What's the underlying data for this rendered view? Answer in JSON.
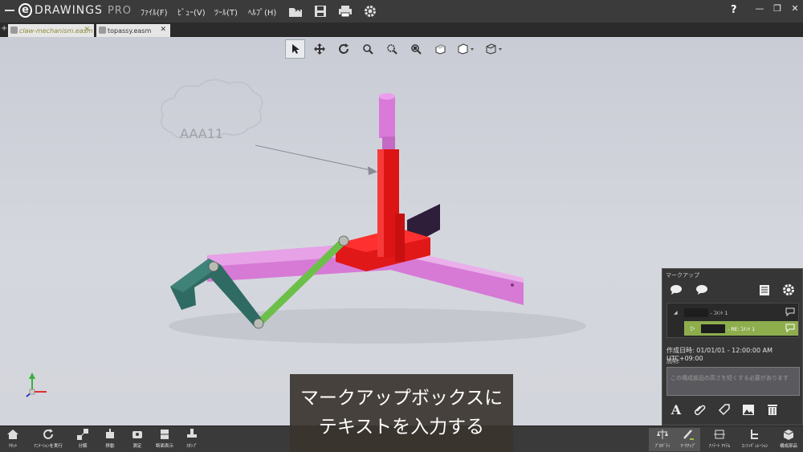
{
  "app": {
    "name": "DRAWINGS",
    "edition": "PRO",
    "logo_letter": "e"
  },
  "menu": [
    "ﾌｧｲﾙ(F)",
    "ﾋﾞｭｰ(V)",
    "ﾂｰﾙ(T)",
    "ﾍﾙﾌﾟ(H)"
  ],
  "window": {
    "help": "?",
    "minimize": "—",
    "restore": "❐",
    "close": "✕"
  },
  "tabs": [
    {
      "label": "claw-mechanism.easm",
      "close": "✕"
    },
    {
      "label": "topassy.easm",
      "close": "✕"
    }
  ],
  "tab_add": "+",
  "model": {
    "cloud_text": "AAA11"
  },
  "markup": {
    "title": "マークアップ",
    "row1_label": "- ｺﾒﾝﾄ 1",
    "row2_label": "- RE: ｺﾒﾝﾄ 1",
    "created": "作成日時: 01/01/01 - 12:00:00 AM UTC+09:00",
    "desc_label": "説明:",
    "desc_text": "この構成部品の高さを短くする必要があります"
  },
  "bottom_left": [
    {
      "label": "ﾘｾｯﾄ",
      "icon": "home-icon"
    },
    {
      "label": "ｱﾆﾒｰｼｮﾝを実行",
      "icon": "animation-icon"
    },
    {
      "label": "分解",
      "icon": "explode-icon"
    },
    {
      "label": "移動",
      "icon": "move-icon"
    },
    {
      "label": "測定",
      "icon": "measure-icon"
    },
    {
      "label": "断面表示",
      "icon": "section-icon"
    },
    {
      "label": "ｽﾀﾝﾌﾟ",
      "icon": "stamp-icon"
    }
  ],
  "bottom_right": [
    {
      "label": "ﾌﾟﾛﾊﾟﾃｨ",
      "icon": "properties-icon"
    },
    {
      "label": "ﾏｰｸｱｯﾌﾟ",
      "icon": "markup-icon"
    },
    {
      "label": "ｱﾉﾃｰﾄ ｱｲﾃﾑ",
      "icon": "annotate-icon"
    },
    {
      "label": "ｺﾝﾌｨｷﾞｭﾚｰｼｮﾝ",
      "icon": "configuration-icon"
    },
    {
      "label": "構成部品",
      "icon": "components-icon"
    }
  ],
  "subtitle": {
    "line1": "マークアップボックスに",
    "line2": "テキストを入力する"
  },
  "colors": {
    "accent": "#9cc04a",
    "markup_selected": "#8eae4e",
    "red_part": "#e01414",
    "magenta_part": "#d77ad8",
    "green_link": "#6cc04a",
    "teal_claw": "#2f6b63"
  }
}
